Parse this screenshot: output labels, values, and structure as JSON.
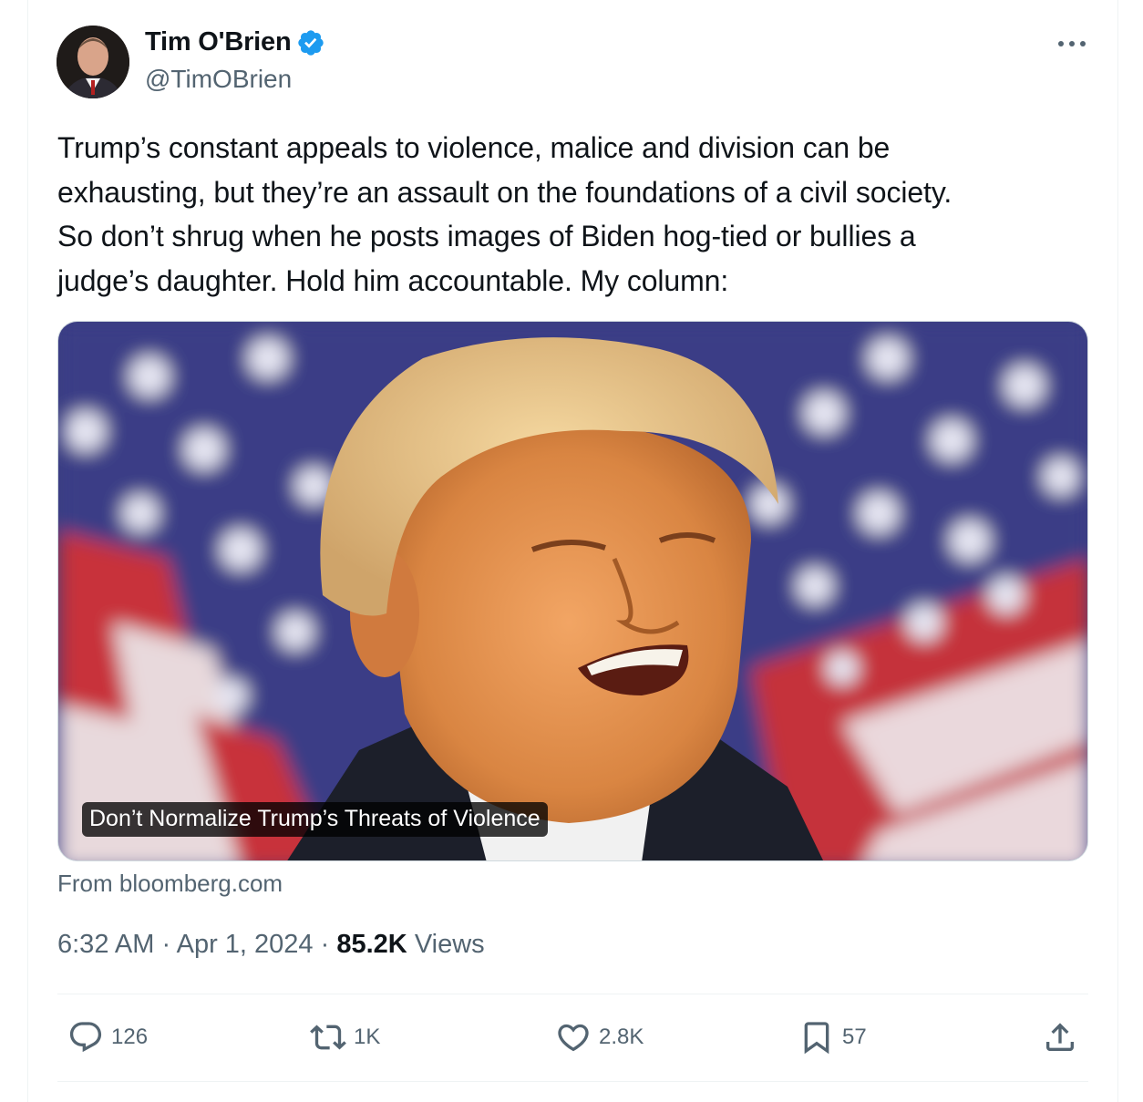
{
  "author": {
    "display_name": "Tim O'Brien",
    "handle": "@TimOBrien",
    "verified": true
  },
  "tweet": {
    "text_lines": [
      "Trump’s constant appeals to violence, malice and division can be",
      "exhausting, but they’re an assault on the foundations of a civil society.",
      "So don’t shrug when he posts images of Biden hog-tied or bullies a",
      "judge’s daughter. Hold him accountable. My column:"
    ]
  },
  "link_card": {
    "headline": "Don’t Normalize Trump’s Threats of Violence",
    "source": "From bloomberg.com"
  },
  "meta": {
    "time": "6:32 AM",
    "date": "Apr 1, 2024",
    "views_count": "85.2K",
    "views_label": "Views",
    "separator": "·"
  },
  "actions": {
    "replies": "126",
    "reposts": "1K",
    "likes": "2.8K",
    "bookmarks": "57"
  },
  "colors": {
    "verified_blue": "#1d9bf0",
    "secondary_text": "#536471",
    "primary_text": "#0f1419"
  }
}
